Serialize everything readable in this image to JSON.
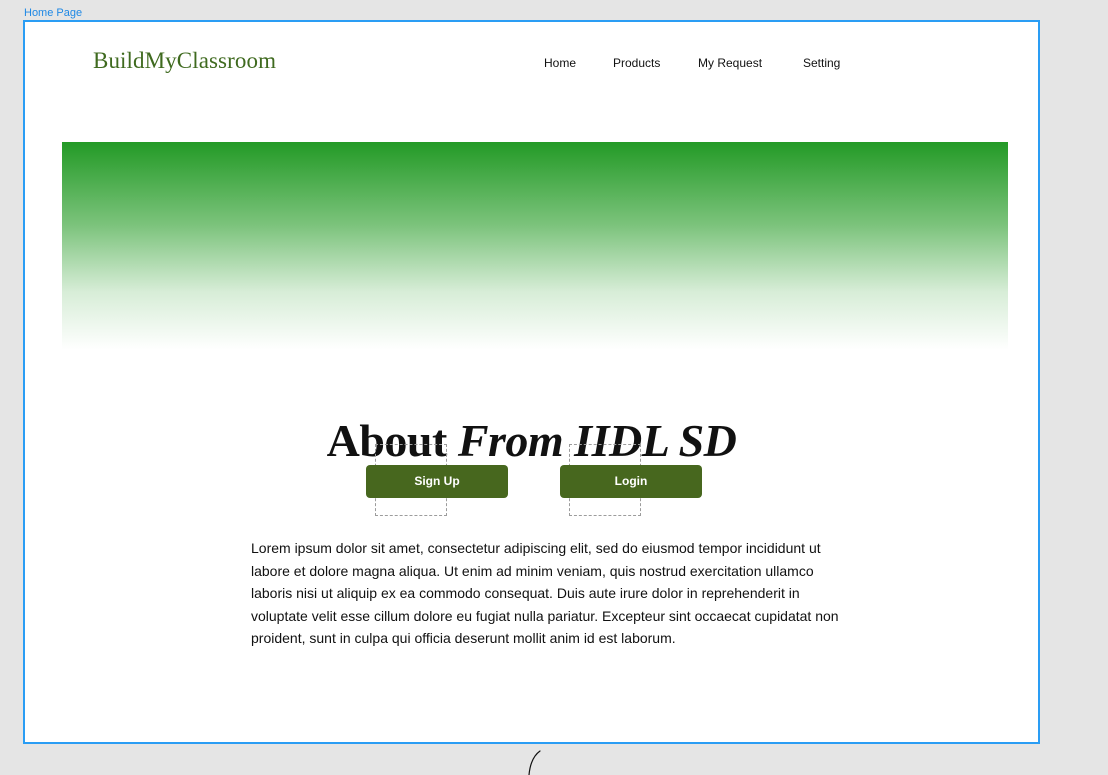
{
  "frame": {
    "label": "Home Page"
  },
  "header": {
    "brand": "BuildMyClassroom",
    "nav": [
      {
        "label": "Home"
      },
      {
        "label": "Products"
      },
      {
        "label": "My Request"
      },
      {
        "label": "Setting"
      }
    ]
  },
  "hero": {
    "gradient_top": "#239a26",
    "gradient_bottom": "#ffffff"
  },
  "main": {
    "headline_regular": "About",
    "headline_italic": "From IIDL SD",
    "signup_button": "Sign Up",
    "login_button": "Login",
    "paragraph": "Lorem ipsum dolor sit amet, consectetur adipiscing elit, sed do eiusmod tempor incididunt ut labore et dolore magna aliqua. Ut enim ad minim veniam, quis nostrud exercitation ullamco laboris nisi ut aliquip ex ea commodo consequat. Duis aute irure dolor in reprehenderit in voluptate velit esse cillum dolore eu fugiat nulla pariatur. Excepteur sint occaecat cupidatat non proident, sunt in culpa qui officia deserunt mollit anim id est laborum."
  },
  "colors": {
    "brand": "#3f6a1f",
    "button": "#47671e",
    "frame_border": "#2a9df4"
  }
}
